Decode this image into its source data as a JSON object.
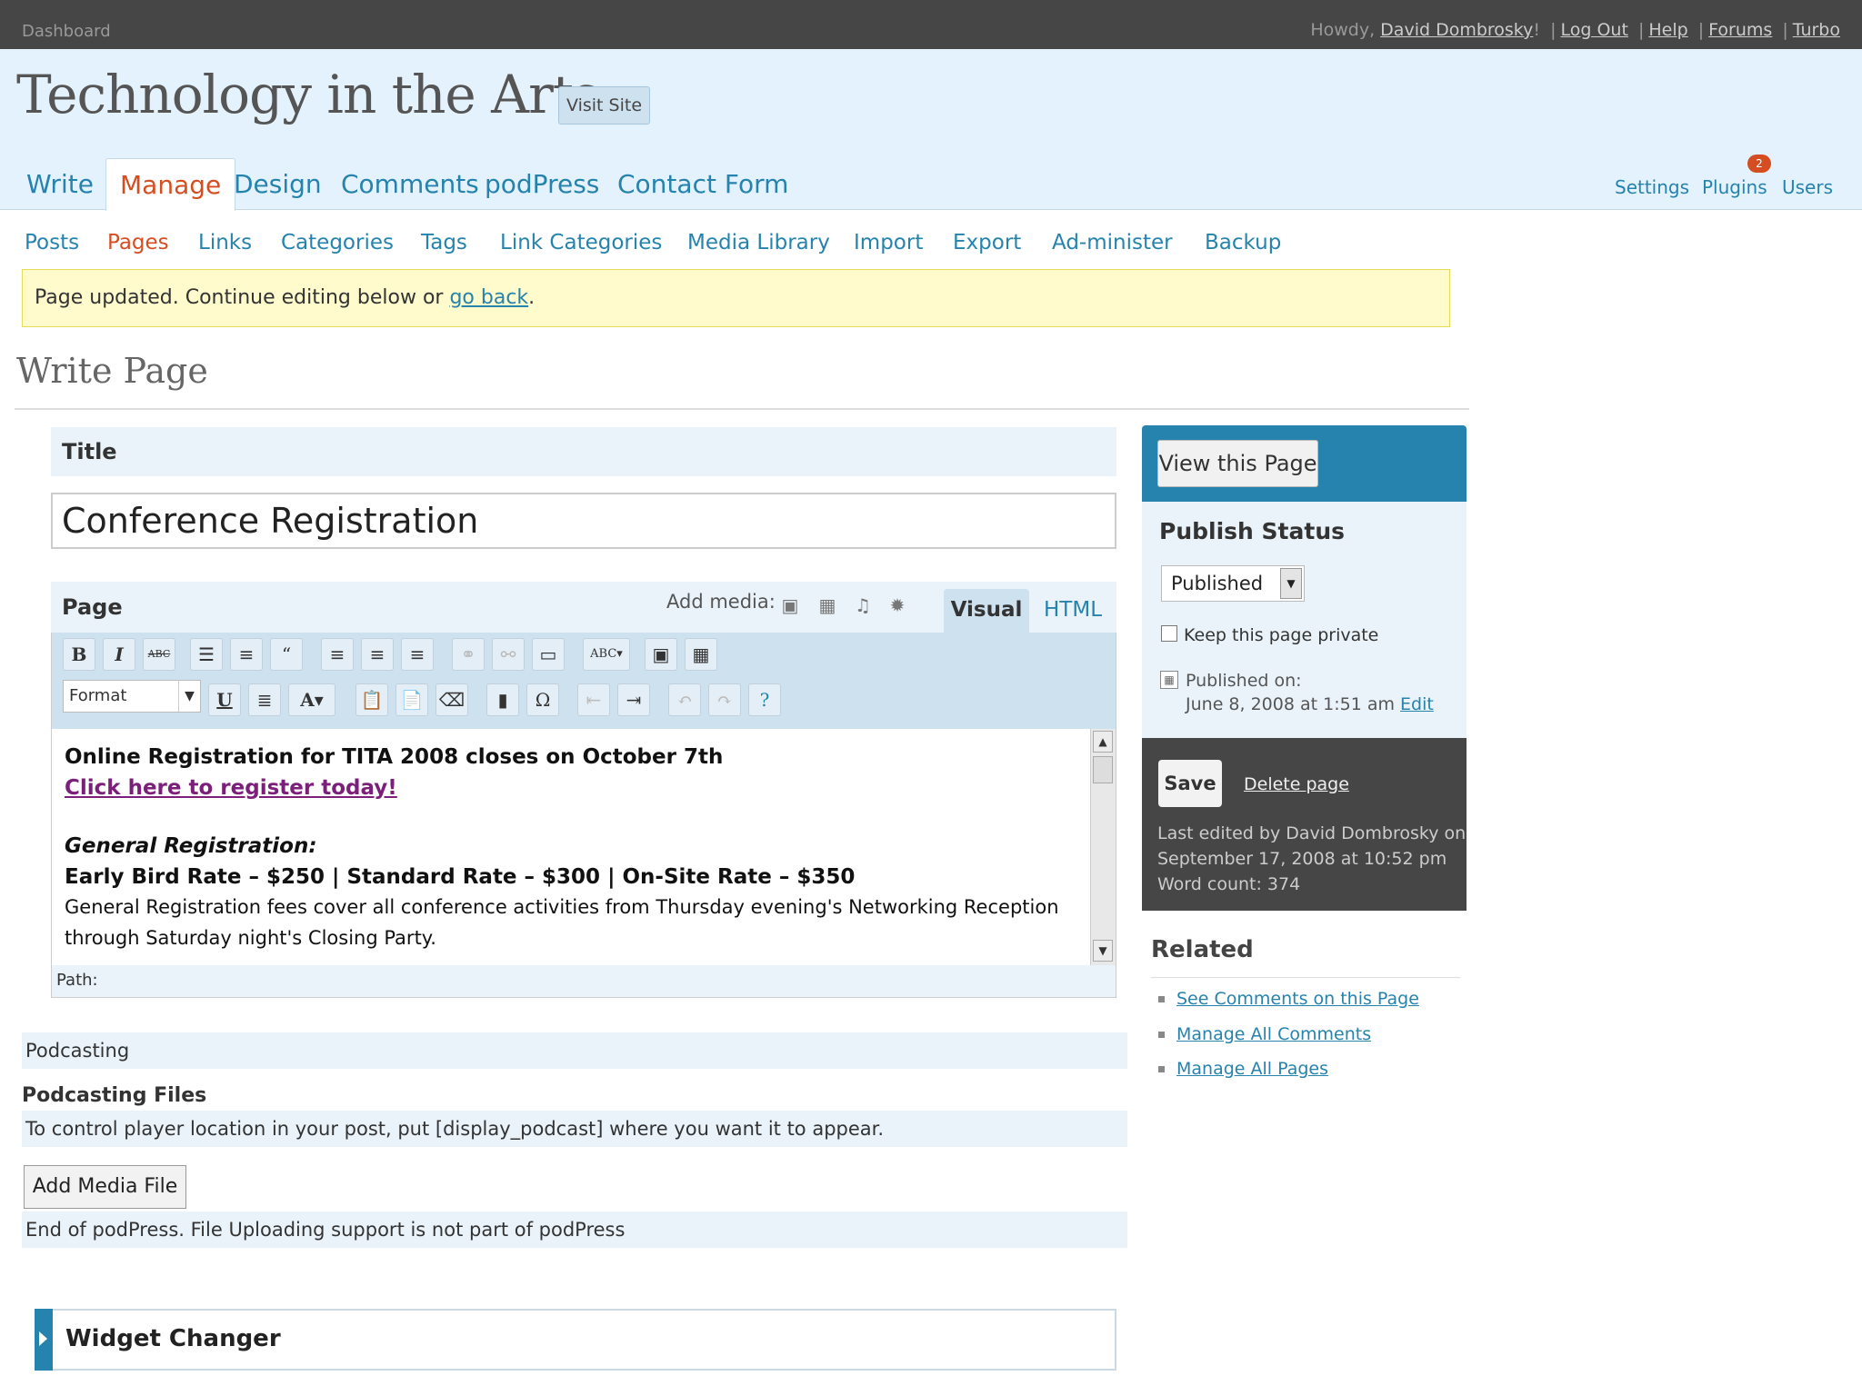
{
  "topbar": {
    "dashboard": "Dashboard",
    "howdy_prefix": "Howdy, ",
    "user": "David Dombrosky",
    "howdy_suffix": "!",
    "links": [
      "Log Out",
      "Help",
      "Forums",
      "Turbo"
    ]
  },
  "header": {
    "site_title": "Technology in the Arts",
    "visit_site": "Visit Site"
  },
  "main_nav": [
    "Write",
    "Manage",
    "Design",
    "Comments",
    "podPress",
    "Contact Form"
  ],
  "right_nav": [
    "Settings",
    "Plugins",
    "Users"
  ],
  "plugins_badge": "2",
  "sub_nav": [
    "Posts",
    "Pages",
    "Links",
    "Categories",
    "Tags",
    "Link Categories",
    "Media Library",
    "Import",
    "Export",
    "Ad-minister",
    "Backup"
  ],
  "notice": {
    "text": "Page updated. Continue editing below or ",
    "link": "go back",
    "end": "."
  },
  "page_heading": "Write Page",
  "title_box": {
    "label": "Title",
    "value": "Conference Registration"
  },
  "editor": {
    "label": "Page",
    "add_media": "Add media:",
    "tab_visual": "Visual",
    "tab_html": "HTML",
    "format_label": "Format",
    "content": {
      "line1": "Online Registration for TITA 2008 closes on October 7th",
      "link": "Click here to register today!",
      "subheading": "General Registration:",
      "rates": "Early Bird Rate – $250 | Standard Rate – $300 | On-Site Rate – $350",
      "desc1": "General Registration fees cover all conference activities from Thursday evening's Networking Reception",
      "desc2": "through Saturday night's Closing Party."
    },
    "path": "Path:"
  },
  "sidebar": {
    "view_page": "View this Page",
    "publish_status": "Publish Status",
    "status_value": "Published",
    "keep_private": "Keep this page private",
    "published_on": "Published on:",
    "published_date": "June 8, 2008 at 1:51 am",
    "edit": "Edit",
    "save": "Save",
    "delete_page": "Delete page",
    "last_edited_1": "Last edited by David Dombrosky on",
    "last_edited_2": "September 17, 2008 at 10:52 pm",
    "word_count": "Word count: 374",
    "related_heading": "Related",
    "related_links": [
      "See Comments on this Page",
      "Manage All Comments",
      "Manage All Pages"
    ]
  },
  "podcasting": {
    "label": "Podcasting",
    "files_heading": "Podcasting Files",
    "instructions": "To control player location in your post, put [display_podcast] where you want it to appear.",
    "add_media_file": "Add Media File",
    "end_note": "End of podPress. File Uploading support is not part of podPress"
  },
  "widget_changer": "Widget Changer"
}
